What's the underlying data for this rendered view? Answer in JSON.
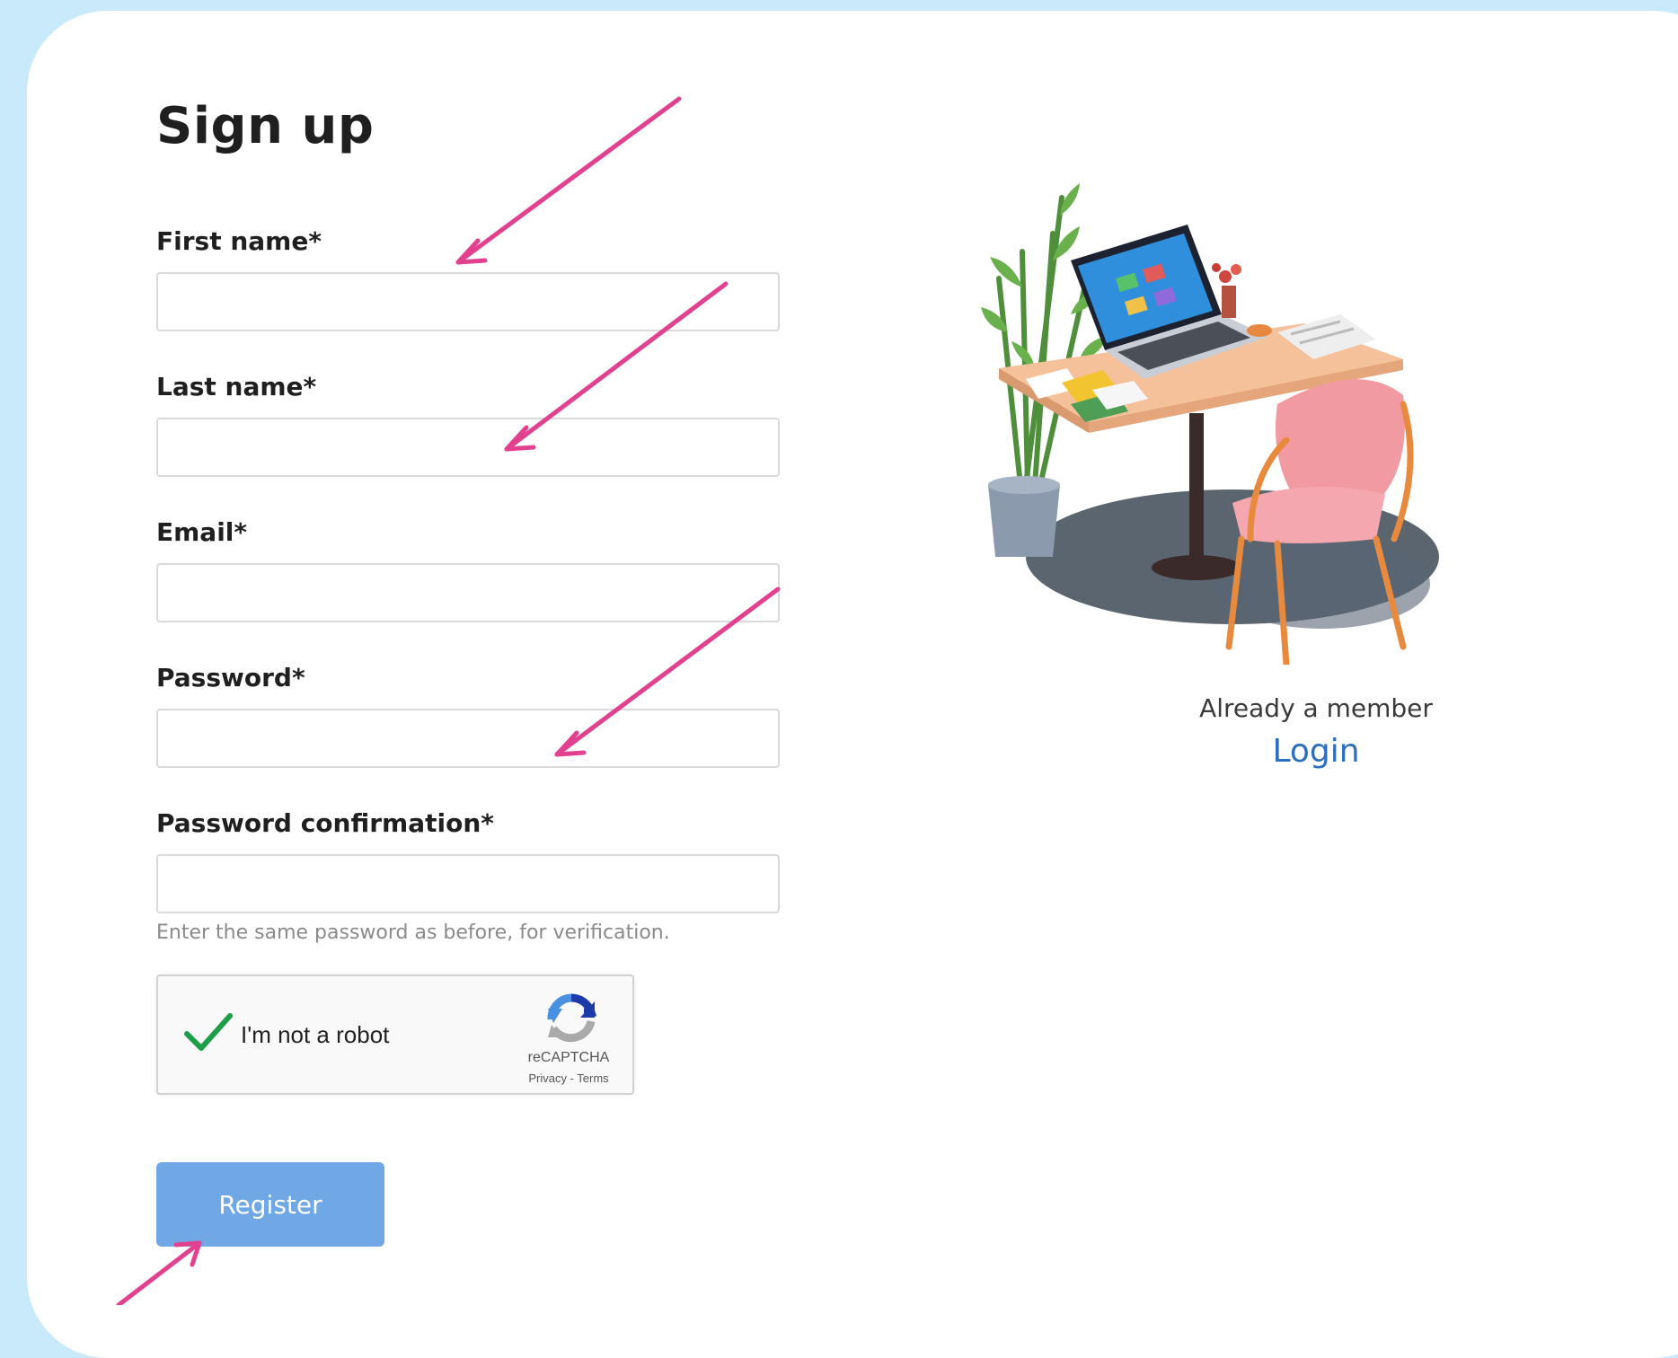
{
  "form": {
    "title": "Sign up",
    "fields": [
      {
        "label": "First name*",
        "value": "",
        "placeholder": ""
      },
      {
        "label": "Last name*",
        "value": "",
        "placeholder": ""
      },
      {
        "label": "Email*",
        "value": "",
        "placeholder": ""
      },
      {
        "label": "Password*",
        "value": "",
        "placeholder": ""
      },
      {
        "label": "Password confirmation*",
        "value": "",
        "placeholder": ""
      }
    ],
    "confirmation_help": "Enter the same password as before, for verification.",
    "register_label": "Register"
  },
  "recaptcha": {
    "label": "I'm not a robot",
    "checked": true,
    "brand": "reCAPTCHA",
    "links": "Privacy - Terms",
    "icon": "recaptcha-logo-icon",
    "check_icon": "checkmark-icon"
  },
  "sidebar": {
    "member_text": "Already a member",
    "login_label": "Login",
    "illustration": "desk-laptop-chair-plant-illustration"
  },
  "annotations": {
    "arrow_color": "#e2418f",
    "arrow_count": 4
  },
  "colors": {
    "background": "#c9eafb",
    "card": "#ffffff",
    "button": "#6fa8e4",
    "link": "#2c6fbf",
    "check": "#1e9e4a"
  }
}
